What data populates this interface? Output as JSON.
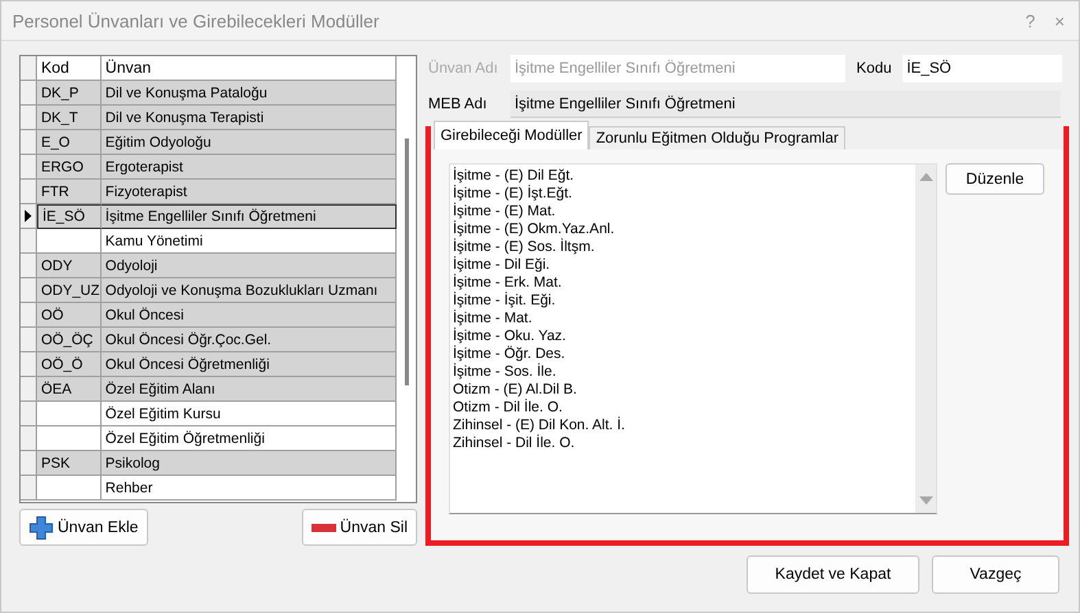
{
  "window": {
    "title": "Personel Ünvanları ve Girebilecekleri Modüller",
    "controls": [
      "?",
      "×"
    ]
  },
  "table": {
    "columns": [
      "Kod",
      "Ünvan"
    ],
    "rows": [
      {
        "code": "DK_P",
        "title": "Dil ve Konuşma Pataloğu",
        "shaded": true,
        "selected": false
      },
      {
        "code": "DK_T",
        "title": "Dil ve Konuşma Terapisti",
        "shaded": true,
        "selected": false
      },
      {
        "code": "E_O",
        "title": "Eğitim Odyoloğu",
        "shaded": true,
        "selected": false
      },
      {
        "code": "ERGO",
        "title": "Ergoterapist",
        "shaded": true,
        "selected": false
      },
      {
        "code": "FTR",
        "title": "Fizyoterapist",
        "shaded": true,
        "selected": false
      },
      {
        "code": "İE_SÖ",
        "title": "İşitme Engelliler Sınıfı Öğretmeni",
        "shaded": true,
        "selected": true
      },
      {
        "title": "Kamu Yönetimi",
        "shaded": false,
        "selected": false
      },
      {
        "code": "ODY",
        "title": "Odyoloji",
        "shaded": true,
        "selected": false
      },
      {
        "code": "ODY_UZ",
        "title": "Odyoloji ve Konuşma Bozuklukları Uzmanı",
        "shaded": true,
        "selected": false
      },
      {
        "code": "OÖ",
        "title": "Okul Öncesi",
        "shaded": true,
        "selected": false
      },
      {
        "code": "OÖ_ÖÇ",
        "title": "Okul Öncesi Öğr.Çoc.Gel.",
        "shaded": true,
        "selected": false
      },
      {
        "code": "OÖ_Ö",
        "title": "Okul Öncesi Öğretmenliği",
        "shaded": true,
        "selected": false
      },
      {
        "code": "ÖEA",
        "title": "Özel Eğitim Alanı",
        "shaded": true,
        "selected": false
      },
      {
        "title": "Özel Eğitim Kursu",
        "shaded": false,
        "selected": false
      },
      {
        "title": "Özel Eğitim Öğretmenliği",
        "shaded": false,
        "selected": false
      },
      {
        "code": "PSK",
        "title": "Psikolog",
        "shaded": true,
        "selected": false
      },
      {
        "title": "Rehber",
        "shaded": false,
        "selected": false
      }
    ]
  },
  "left_buttons": [
    "Ünvan Ekle",
    "Ünvan Sil"
  ],
  "form": {
    "title_label": "Ünvan Adı",
    "title_value": "İşitme Engelliler Sınıfı Öğretmeni",
    "code_label": "Kodu",
    "code_value": "İE_SÖ",
    "meb_label": "MEB Adı",
    "meb_value": "İşitme Engelliler Sınıfı Öğretmeni"
  },
  "tabs": [
    {
      "label": "Girebileceği Modüller",
      "selected": true
    },
    {
      "label": "Zorunlu Eğitmen Olduğu Programlar",
      "selected": false
    }
  ],
  "modules": [
    "İşitme - (E) Dil Eğt.",
    "İşitme - (E) İşt.Eğt.",
    "İşitme - (E) Mat.",
    "İşitme - (E) Okm.Yaz.Anl.",
    "İşitme - (E) Sos. İltşm.",
    "İşitme - Dil Eği.",
    "İşitme - Erk. Mat.",
    "İşitme - İşit. Eği.",
    "İşitme - Mat.",
    "İşitme - Oku. Yaz.",
    "İşitme - Öğr. Des.",
    "İşitme - Sos. İle.",
    "Otizm - (E) Al.Dil B.",
    "Otizm - Dil İle. O.",
    "Zihinsel - (E) Dil Kon. Alt. İ.",
    "Zihinsel - Dil İle. O."
  ],
  "edit_button": "Düzenle",
  "footer_buttons": [
    "Kaydet ve Kapat",
    "Vazgeç"
  ]
}
